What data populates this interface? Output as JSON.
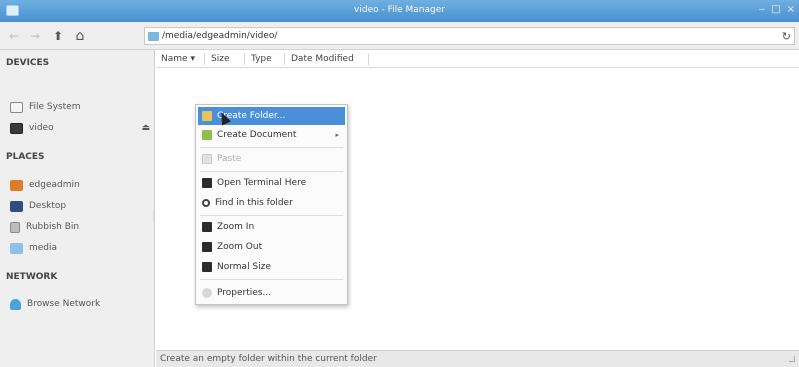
{
  "window": {
    "title": "video - File Manager",
    "controls": [
      "‒",
      "□",
      "×"
    ]
  },
  "toolbar": {
    "location": "/media/edgeadmin/video/",
    "back_icon": "←",
    "forward_icon": "→",
    "up_icon": "⬆",
    "home_icon": "⌂",
    "reload_icon": "↻"
  },
  "sidebar": {
    "devices_header": "DEVICES",
    "devices": [
      {
        "label": "File System",
        "icon": "drive-icon"
      },
      {
        "label": "video",
        "icon": "usb-drive-icon",
        "eject": "⏏"
      }
    ],
    "places_header": "PLACES",
    "places": [
      {
        "label": "edgeadmin",
        "icon": "home-icon"
      },
      {
        "label": "Desktop",
        "icon": "desktop-icon"
      },
      {
        "label": "Rubbish Bin",
        "icon": "trash-icon"
      },
      {
        "label": "media",
        "icon": "folder-icon"
      }
    ],
    "network_header": "NETWORK",
    "network": [
      {
        "label": "Browse Network",
        "icon": "network-icon"
      }
    ]
  },
  "columns": {
    "name": "Name",
    "sort_indicator": "▾",
    "size": "Size",
    "type": "Type",
    "modified": "Date Modified"
  },
  "context_menu": {
    "items": [
      {
        "label": "Create Folder...",
        "icon": "new-folder-icon",
        "active": true
      },
      {
        "label": "Create Document",
        "icon": "new-document-icon",
        "submenu": "▸"
      },
      {
        "label": "Paste",
        "icon": "paste-icon",
        "disabled": true
      },
      {
        "label": "Open Terminal Here",
        "icon": "terminal-icon"
      },
      {
        "label": "Find in this folder",
        "icon": "search-icon"
      },
      {
        "label": "Zoom In",
        "icon": "zoom-in-icon"
      },
      {
        "label": "Zoom Out",
        "icon": "zoom-out-icon"
      },
      {
        "label": "Normal Size",
        "icon": "normal-size-icon"
      },
      {
        "label": "Properties...",
        "icon": "properties-icon"
      }
    ]
  },
  "statusbar": {
    "text": "Create an empty folder within the current folder"
  },
  "colors": {
    "titlebar": "#4a90cf",
    "accent": "#4a90d9"
  }
}
